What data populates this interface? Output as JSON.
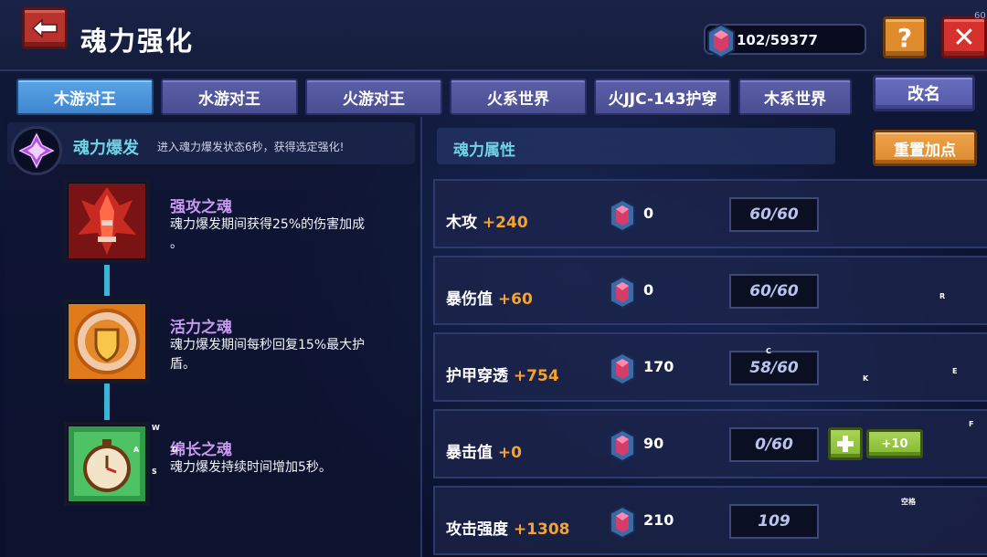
{
  "header": {
    "title": "魂力强化",
    "soul_count": "102/59377",
    "help_label": "?",
    "close_label": "✕",
    "corner_badge": "60"
  },
  "tabs": [
    {
      "label": "木游对王",
      "active": true
    },
    {
      "label": "水游对王",
      "active": false
    },
    {
      "label": "火游对王",
      "active": false
    },
    {
      "label": "火系世界",
      "active": false
    },
    {
      "label": "火JJC-143护穿",
      "active": false
    },
    {
      "label": "木系世界",
      "active": false
    }
  ],
  "rename_label": "改名",
  "burst": {
    "title": "魂力爆发",
    "description": "进入魂力爆发状态6秒，获得选定强化!"
  },
  "skills": [
    {
      "name": "强攻之魂",
      "line1": "魂力爆发期间获得25%的伤害加成",
      "line2": "。",
      "icon": "red-flame-sword-icon"
    },
    {
      "name": "活力之魂",
      "line1": "魂力爆发期间每秒回复15%最大护",
      "line2": "盾。",
      "icon": "golden-shield-icon"
    },
    {
      "name": "绵长之魂",
      "line1": "魂力爆发持续时间增加5秒。",
      "line2": "",
      "icon": "green-stopwatch-icon"
    }
  ],
  "attributes": {
    "header": "魂力属性",
    "reset_label": "重置加点",
    "plus10_label": "+10",
    "rows": [
      {
        "name": "木攻",
        "bonus": "+240",
        "cost": "0",
        "level": "60/60",
        "upgradable": false
      },
      {
        "name": "暴伤值",
        "bonus": "+60",
        "cost": "0",
        "level": "60/60",
        "upgradable": false
      },
      {
        "name": "护甲穿透",
        "bonus": "+754",
        "cost": "170",
        "level": "58/60",
        "upgradable": false
      },
      {
        "name": "暴击值",
        "bonus": "+0",
        "cost": "90",
        "level": "0/60",
        "upgradable": true
      },
      {
        "name": "攻击强度",
        "bonus": "+1308",
        "cost": "210",
        "level": "109",
        "upgradable": false
      }
    ]
  },
  "keyboard_hints": {
    "w": "W",
    "a": "A",
    "s": "S",
    "d": "D",
    "r": "R",
    "c": "C",
    "k": "K",
    "e": "E",
    "f": "F",
    "space": "空格"
  }
}
